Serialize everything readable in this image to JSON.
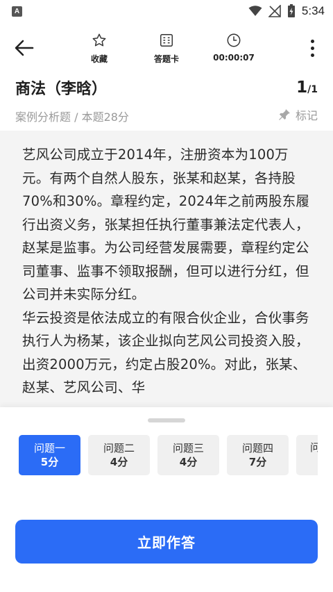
{
  "status_bar": {
    "app_badge": "A",
    "time": "5:34"
  },
  "toolbar": {
    "favorite_label": "收藏",
    "answer_card_label": "答题卡",
    "timer": "00:00:07"
  },
  "question": {
    "title": "商法（李晗）",
    "current": "1",
    "total": "/1",
    "subtitle": "案例分析题 / 本题28分",
    "mark_label": "标记",
    "paragraphs": [
      "艺风公司成立于2014年，注册资本为100万元。有两个自然人股东，张某和赵某，各持股70%和30%。章程约定，2024年之前两股东履行出资义务，张某担任执行董事兼法定代表人，赵某是监事。为公司经营发展需要，章程约定公司董事、监事不领取报酬，但可以进行分红，但公司并未实际分红。",
      "华云投资是依法成立的有限合伙企业，合伙事务执行人为杨某，该企业拟向艺风公司投资入股，出资2000万元，约定占股20%。对此，张某、赵某、艺风公司、华"
    ]
  },
  "sub_questions": [
    {
      "name": "问题一",
      "score": "5分",
      "active": true
    },
    {
      "name": "问题二",
      "score": "4分",
      "active": false
    },
    {
      "name": "问题三",
      "score": "4分",
      "active": false
    },
    {
      "name": "问题四",
      "score": "7分",
      "active": false
    },
    {
      "name": "问",
      "score": "",
      "active": false
    }
  ],
  "actions": {
    "answer_now": "立即作答"
  },
  "colors": {
    "primary": "#2b6cf6",
    "content_bg": "#f4f4f4",
    "muted_text": "#9a9a9a"
  }
}
